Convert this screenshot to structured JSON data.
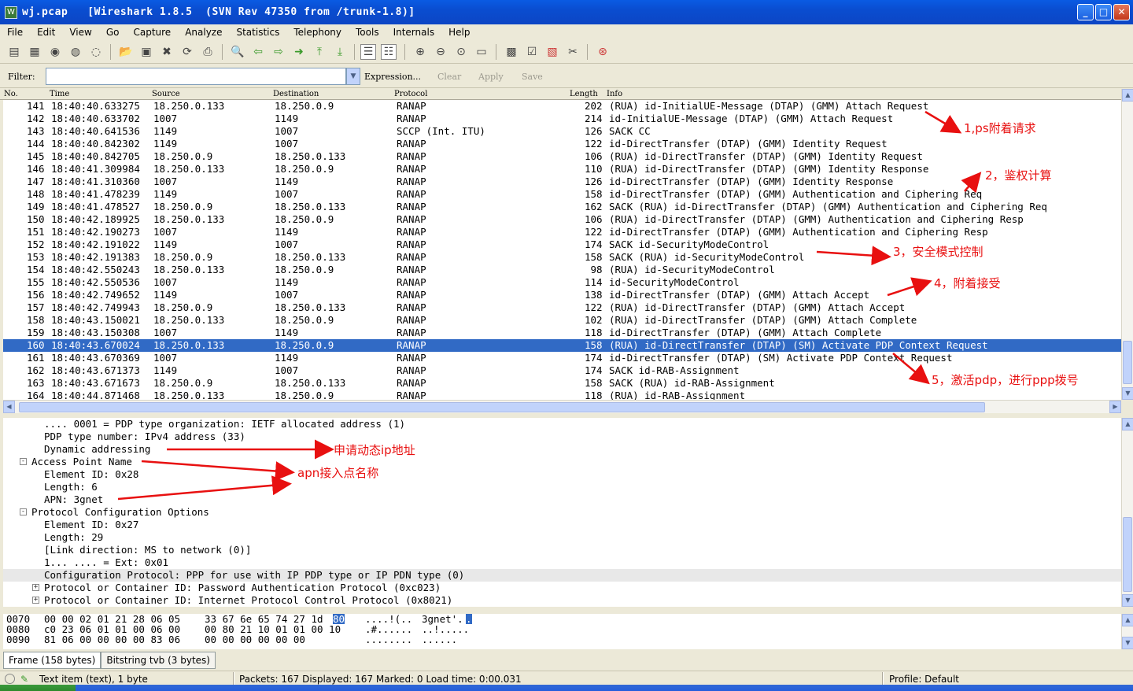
{
  "window": {
    "title": "wj.pcap   [Wireshark 1.8.5  (SVN Rev 47350 from /trunk-1.8)]",
    "icon_text": "W"
  },
  "menu": [
    "File",
    "Edit",
    "View",
    "Go",
    "Capture",
    "Analyze",
    "Statistics",
    "Telephony",
    "Tools",
    "Internals",
    "Help"
  ],
  "filter": {
    "label": "Filter:",
    "value": "",
    "expression": "Expression...",
    "clear": "Clear",
    "apply": "Apply",
    "save": "Save"
  },
  "columns": [
    "No.",
    "Time",
    "Source",
    "Destination",
    "Protocol",
    "Length",
    "Info"
  ],
  "packets": [
    {
      "no": "141",
      "time": "18:40:40.633275",
      "src": "18.250.0.133",
      "dst": "18.250.0.9",
      "proto": "RANAP",
      "len": "202",
      "info": "(RUA) id-InitialUE-Message (DTAP) (GMM) Attach Request"
    },
    {
      "no": "142",
      "time": "18:40:40.633702",
      "src": "1007",
      "dst": "1149",
      "proto": "RANAP",
      "len": "214",
      "info": "id-InitialUE-Message (DTAP) (GMM) Attach Request"
    },
    {
      "no": "143",
      "time": "18:40:40.641536",
      "src": "1149",
      "dst": "1007",
      "proto": "SCCP (Int. ITU)",
      "len": "126",
      "info": "SACK CC"
    },
    {
      "no": "144",
      "time": "18:40:40.842302",
      "src": "1149",
      "dst": "1007",
      "proto": "RANAP",
      "len": "122",
      "info": "id-DirectTransfer (DTAP) (GMM) Identity Request"
    },
    {
      "no": "145",
      "time": "18:40:40.842705",
      "src": "18.250.0.9",
      "dst": "18.250.0.133",
      "proto": "RANAP",
      "len": "106",
      "info": "(RUA) id-DirectTransfer (DTAP) (GMM) Identity Request"
    },
    {
      "no": "146",
      "time": "18:40:41.309984",
      "src": "18.250.0.133",
      "dst": "18.250.0.9",
      "proto": "RANAP",
      "len": "110",
      "info": "(RUA) id-DirectTransfer (DTAP) (GMM) Identity Response"
    },
    {
      "no": "147",
      "time": "18:40:41.310360",
      "src": "1007",
      "dst": "1149",
      "proto": "RANAP",
      "len": "126",
      "info": "id-DirectTransfer (DTAP) (GMM) Identity Response"
    },
    {
      "no": "148",
      "time": "18:40:41.478239",
      "src": "1149",
      "dst": "1007",
      "proto": "RANAP",
      "len": "158",
      "info": "id-DirectTransfer (DTAP) (GMM) Authentication and Ciphering Req"
    },
    {
      "no": "149",
      "time": "18:40:41.478527",
      "src": "18.250.0.9",
      "dst": "18.250.0.133",
      "proto": "RANAP",
      "len": "162",
      "info": "SACK (RUA) id-DirectTransfer (DTAP) (GMM) Authentication and Ciphering Req"
    },
    {
      "no": "150",
      "time": "18:40:42.189925",
      "src": "18.250.0.133",
      "dst": "18.250.0.9",
      "proto": "RANAP",
      "len": "106",
      "info": "(RUA) id-DirectTransfer (DTAP) (GMM) Authentication and Ciphering Resp"
    },
    {
      "no": "151",
      "time": "18:40:42.190273",
      "src": "1007",
      "dst": "1149",
      "proto": "RANAP",
      "len": "122",
      "info": "id-DirectTransfer (DTAP) (GMM) Authentication and Ciphering Resp"
    },
    {
      "no": "152",
      "time": "18:40:42.191022",
      "src": "1149",
      "dst": "1007",
      "proto": "RANAP",
      "len": "174",
      "info": "SACK id-SecurityModeControl"
    },
    {
      "no": "153",
      "time": "18:40:42.191383",
      "src": "18.250.0.9",
      "dst": "18.250.0.133",
      "proto": "RANAP",
      "len": "158",
      "info": "SACK (RUA) id-SecurityModeControl"
    },
    {
      "no": "154",
      "time": "18:40:42.550243",
      "src": "18.250.0.133",
      "dst": "18.250.0.9",
      "proto": "RANAP",
      "len": " 98",
      "info": "(RUA) id-SecurityModeControl"
    },
    {
      "no": "155",
      "time": "18:40:42.550536",
      "src": "1007",
      "dst": "1149",
      "proto": "RANAP",
      "len": "114",
      "info": "id-SecurityModeControl"
    },
    {
      "no": "156",
      "time": "18:40:42.749652",
      "src": "1149",
      "dst": "1007",
      "proto": "RANAP",
      "len": "138",
      "info": "id-DirectTransfer (DTAP) (GMM) Attach Accept"
    },
    {
      "no": "157",
      "time": "18:40:42.749943",
      "src": "18.250.0.9",
      "dst": "18.250.0.133",
      "proto": "RANAP",
      "len": "122",
      "info": "(RUA) id-DirectTransfer (DTAP) (GMM) Attach Accept"
    },
    {
      "no": "158",
      "time": "18:40:43.150021",
      "src": "18.250.0.133",
      "dst": "18.250.0.9",
      "proto": "RANAP",
      "len": "102",
      "info": "(RUA) id-DirectTransfer (DTAP) (GMM) Attach Complete"
    },
    {
      "no": "159",
      "time": "18:40:43.150308",
      "src": "1007",
      "dst": "1149",
      "proto": "RANAP",
      "len": "118",
      "info": "id-DirectTransfer (DTAP) (GMM) Attach Complete"
    },
    {
      "no": "160",
      "time": "18:40:43.670024",
      "src": "18.250.0.133",
      "dst": "18.250.0.9",
      "proto": "RANAP",
      "len": "158",
      "info": "(RUA) id-DirectTransfer (DTAP) (SM) Activate PDP Context Request",
      "selected": true
    },
    {
      "no": "161",
      "time": "18:40:43.670369",
      "src": "1007",
      "dst": "1149",
      "proto": "RANAP",
      "len": "174",
      "info": "id-DirectTransfer (DTAP) (SM) Activate PDP Context Request"
    },
    {
      "no": "162",
      "time": "18:40:43.671373",
      "src": "1149",
      "dst": "1007",
      "proto": "RANAP",
      "len": "174",
      "info": "SACK id-RAB-Assignment"
    },
    {
      "no": "163",
      "time": "18:40:43.671673",
      "src": "18.250.0.9",
      "dst": "18.250.0.133",
      "proto": "RANAP",
      "len": "158",
      "info": "SACK (RUA) id-RAB-Assignment"
    },
    {
      "no": "164",
      "time": "18:40:44.871468",
      "src": "18.250.0.133",
      "dst": "18.250.0.9",
      "proto": "RANAP",
      "len": "118",
      "info": "(RUA) id-RAB-Assignment"
    }
  ],
  "details": [
    {
      "text": ".... 0001 = PDP type organization: IETF allocated address (1)",
      "indent": 3
    },
    {
      "text": "PDP type number: IPv4 address (33)",
      "indent": 3
    },
    {
      "text": "Dynamic addressing",
      "indent": 3
    },
    {
      "text": "Access Point Name",
      "indent": 2,
      "expander": "-"
    },
    {
      "text": "Element ID: 0x28",
      "indent": 3
    },
    {
      "text": "Length: 6",
      "indent": 3
    },
    {
      "text": "APN: 3gnet",
      "indent": 3
    },
    {
      "text": "Protocol Configuration Options",
      "indent": 2,
      "expander": "-"
    },
    {
      "text": "Element ID: 0x27",
      "indent": 3
    },
    {
      "text": "Length: 29",
      "indent": 3
    },
    {
      "text": "[Link direction: MS to network (0)]",
      "indent": 3
    },
    {
      "text": "1... .... = Ext: 0x01",
      "indent": 3
    },
    {
      "text": "Configuration Protocol: PPP for use with IP PDP type or IP PDN type (0)",
      "indent": 3,
      "highlight": true
    },
    {
      "text": "Protocol or Container ID: Password Authentication Protocol (0xc023)",
      "indent": 3,
      "expander": "+"
    },
    {
      "text": "Protocol or Container ID: Internet Protocol Control Protocol (0x8021)",
      "indent": 3,
      "expander": "+"
    }
  ],
  "hex": [
    {
      "offset": "0070",
      "bytes_a": "00 00 02 01 21 28 06 05",
      "bytes_b": "33 67 6e 65 74 27 1d",
      "sel_byte": "80",
      "ascii_a": "....!(..",
      "ascii_b": "3gnet'.",
      "sel_ascii": "."
    },
    {
      "offset": "0080",
      "bytes_a": "c0 23 06 01 01 00 06 00",
      "bytes_b": "00 80 21 10 01 01 00 10",
      "sel_byte": "",
      "ascii_a": ".#......",
      "ascii_b": "..!.....",
      "sel_ascii": ""
    },
    {
      "offset": "0090",
      "bytes_a": "81 06 00 00 00 00 83 06",
      "bytes_b": "00 00 00 00 00 00",
      "sel_byte": "",
      "ascii_a": "........",
      "ascii_b": "......",
      "sel_ascii": ""
    }
  ],
  "tabs": [
    "Frame (158 bytes)",
    "Bitstring tvb (3 bytes)"
  ],
  "status": {
    "item": "Text item (text), 1 byte",
    "packets": "Packets: 167 Displayed: 167 Marked: 0 Load time: 0:00.031",
    "profile": "Profile: Default"
  },
  "annotations": {
    "a1": "1,ps附着请求",
    "a2": "2，鉴权计算",
    "a3": "3，安全模式控制",
    "a4": "4，附着接受",
    "a5": "5，激活pdp，进行ppp拨号",
    "a6": "申请动态ip地址",
    "a7": "apn接入点名称"
  },
  "colors": {
    "selection": "#316ac5",
    "annotation": "#e81010",
    "titlebar": "#0a5be3"
  }
}
